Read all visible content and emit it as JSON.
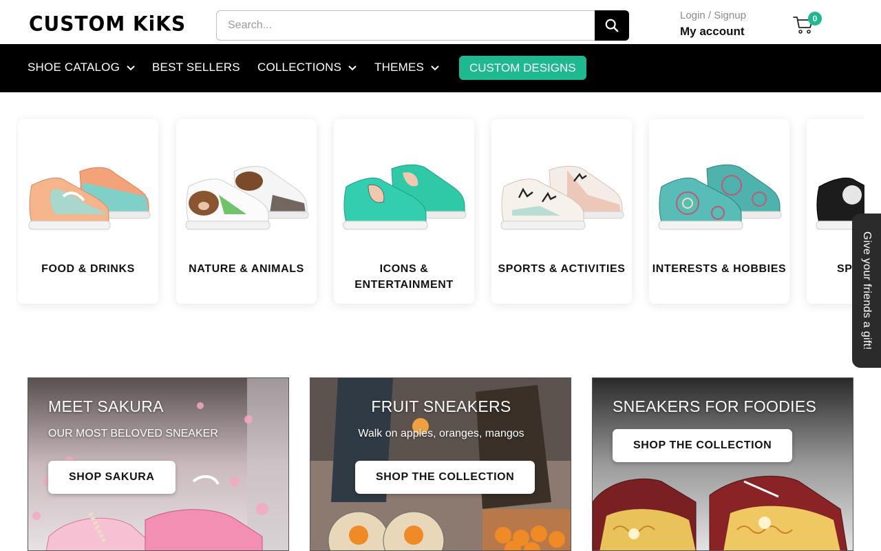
{
  "header": {
    "logo": "CUSTOM KiKS",
    "search_placeholder": "Search...",
    "login_label": "Login / Signup",
    "account_label": "My account",
    "cart_count": "0"
  },
  "nav": {
    "items": [
      {
        "label": "SHOE CATALOG"
      },
      {
        "label": "BEST SELLERS"
      },
      {
        "label": "COLLECTIONS"
      },
      {
        "label": "THEMES"
      }
    ],
    "cta": "CUSTOM DESIGNS"
  },
  "categories": [
    {
      "label": "FOOD & DRINKS"
    },
    {
      "label": "NATURE & ANIMALS"
    },
    {
      "label": "ICONS & ENTERTAINMENT"
    },
    {
      "label": "SPORTS & ACTIVITIES"
    },
    {
      "label": "INTERESTS & HOBBIES"
    },
    {
      "label": "SP"
    }
  ],
  "gift_tab": "Give your friends a gift!",
  "banners": [
    {
      "title": "MEET SAKURA",
      "subtitle": "OUR MOST BELOVED SNEAKER",
      "button": "SHOP SAKURA"
    },
    {
      "title": "FRUIT SNEAKERS",
      "subtitle": "Walk on apples, oranges, mangos",
      "button": "SHOP THE COLLECTION"
    },
    {
      "title": "SNEAKERS FOR FOODIES",
      "button": "SHOP THE COLLECTION"
    }
  ],
  "colors": {
    "accent": "#1fb98f",
    "nav_bg": "#000000"
  }
}
